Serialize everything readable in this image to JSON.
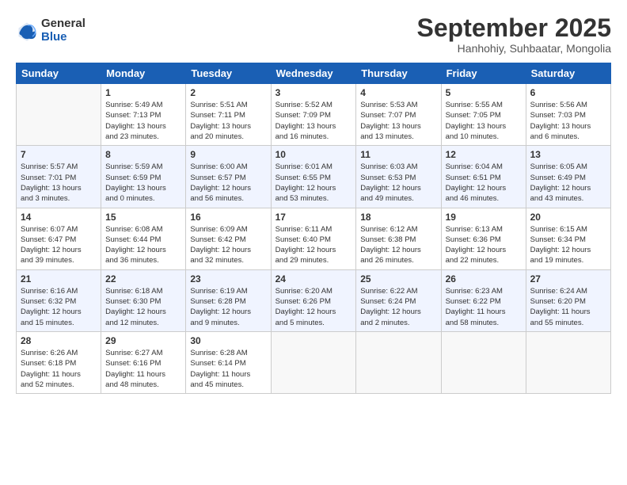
{
  "header": {
    "logo_general": "General",
    "logo_blue": "Blue",
    "month_title": "September 2025",
    "location": "Hanhohiy, Suhbaatar, Mongolia"
  },
  "weekdays": [
    "Sunday",
    "Monday",
    "Tuesday",
    "Wednesday",
    "Thursday",
    "Friday",
    "Saturday"
  ],
  "weeks": [
    [
      {
        "day": "",
        "info": ""
      },
      {
        "day": "1",
        "info": "Sunrise: 5:49 AM\nSunset: 7:13 PM\nDaylight: 13 hours\nand 23 minutes."
      },
      {
        "day": "2",
        "info": "Sunrise: 5:51 AM\nSunset: 7:11 PM\nDaylight: 13 hours\nand 20 minutes."
      },
      {
        "day": "3",
        "info": "Sunrise: 5:52 AM\nSunset: 7:09 PM\nDaylight: 13 hours\nand 16 minutes."
      },
      {
        "day": "4",
        "info": "Sunrise: 5:53 AM\nSunset: 7:07 PM\nDaylight: 13 hours\nand 13 minutes."
      },
      {
        "day": "5",
        "info": "Sunrise: 5:55 AM\nSunset: 7:05 PM\nDaylight: 13 hours\nand 10 minutes."
      },
      {
        "day": "6",
        "info": "Sunrise: 5:56 AM\nSunset: 7:03 PM\nDaylight: 13 hours\nand 6 minutes."
      }
    ],
    [
      {
        "day": "7",
        "info": "Sunrise: 5:57 AM\nSunset: 7:01 PM\nDaylight: 13 hours\nand 3 minutes."
      },
      {
        "day": "8",
        "info": "Sunrise: 5:59 AM\nSunset: 6:59 PM\nDaylight: 13 hours\nand 0 minutes."
      },
      {
        "day": "9",
        "info": "Sunrise: 6:00 AM\nSunset: 6:57 PM\nDaylight: 12 hours\nand 56 minutes."
      },
      {
        "day": "10",
        "info": "Sunrise: 6:01 AM\nSunset: 6:55 PM\nDaylight: 12 hours\nand 53 minutes."
      },
      {
        "day": "11",
        "info": "Sunrise: 6:03 AM\nSunset: 6:53 PM\nDaylight: 12 hours\nand 49 minutes."
      },
      {
        "day": "12",
        "info": "Sunrise: 6:04 AM\nSunset: 6:51 PM\nDaylight: 12 hours\nand 46 minutes."
      },
      {
        "day": "13",
        "info": "Sunrise: 6:05 AM\nSunset: 6:49 PM\nDaylight: 12 hours\nand 43 minutes."
      }
    ],
    [
      {
        "day": "14",
        "info": "Sunrise: 6:07 AM\nSunset: 6:47 PM\nDaylight: 12 hours\nand 39 minutes."
      },
      {
        "day": "15",
        "info": "Sunrise: 6:08 AM\nSunset: 6:44 PM\nDaylight: 12 hours\nand 36 minutes."
      },
      {
        "day": "16",
        "info": "Sunrise: 6:09 AM\nSunset: 6:42 PM\nDaylight: 12 hours\nand 32 minutes."
      },
      {
        "day": "17",
        "info": "Sunrise: 6:11 AM\nSunset: 6:40 PM\nDaylight: 12 hours\nand 29 minutes."
      },
      {
        "day": "18",
        "info": "Sunrise: 6:12 AM\nSunset: 6:38 PM\nDaylight: 12 hours\nand 26 minutes."
      },
      {
        "day": "19",
        "info": "Sunrise: 6:13 AM\nSunset: 6:36 PM\nDaylight: 12 hours\nand 22 minutes."
      },
      {
        "day": "20",
        "info": "Sunrise: 6:15 AM\nSunset: 6:34 PM\nDaylight: 12 hours\nand 19 minutes."
      }
    ],
    [
      {
        "day": "21",
        "info": "Sunrise: 6:16 AM\nSunset: 6:32 PM\nDaylight: 12 hours\nand 15 minutes."
      },
      {
        "day": "22",
        "info": "Sunrise: 6:18 AM\nSunset: 6:30 PM\nDaylight: 12 hours\nand 12 minutes."
      },
      {
        "day": "23",
        "info": "Sunrise: 6:19 AM\nSunset: 6:28 PM\nDaylight: 12 hours\nand 9 minutes."
      },
      {
        "day": "24",
        "info": "Sunrise: 6:20 AM\nSunset: 6:26 PM\nDaylight: 12 hours\nand 5 minutes."
      },
      {
        "day": "25",
        "info": "Sunrise: 6:22 AM\nSunset: 6:24 PM\nDaylight: 12 hours\nand 2 minutes."
      },
      {
        "day": "26",
        "info": "Sunrise: 6:23 AM\nSunset: 6:22 PM\nDaylight: 11 hours\nand 58 minutes."
      },
      {
        "day": "27",
        "info": "Sunrise: 6:24 AM\nSunset: 6:20 PM\nDaylight: 11 hours\nand 55 minutes."
      }
    ],
    [
      {
        "day": "28",
        "info": "Sunrise: 6:26 AM\nSunset: 6:18 PM\nDaylight: 11 hours\nand 52 minutes."
      },
      {
        "day": "29",
        "info": "Sunrise: 6:27 AM\nSunset: 6:16 PM\nDaylight: 11 hours\nand 48 minutes."
      },
      {
        "day": "30",
        "info": "Sunrise: 6:28 AM\nSunset: 6:14 PM\nDaylight: 11 hours\nand 45 minutes."
      },
      {
        "day": "",
        "info": ""
      },
      {
        "day": "",
        "info": ""
      },
      {
        "day": "",
        "info": ""
      },
      {
        "day": "",
        "info": ""
      }
    ]
  ]
}
